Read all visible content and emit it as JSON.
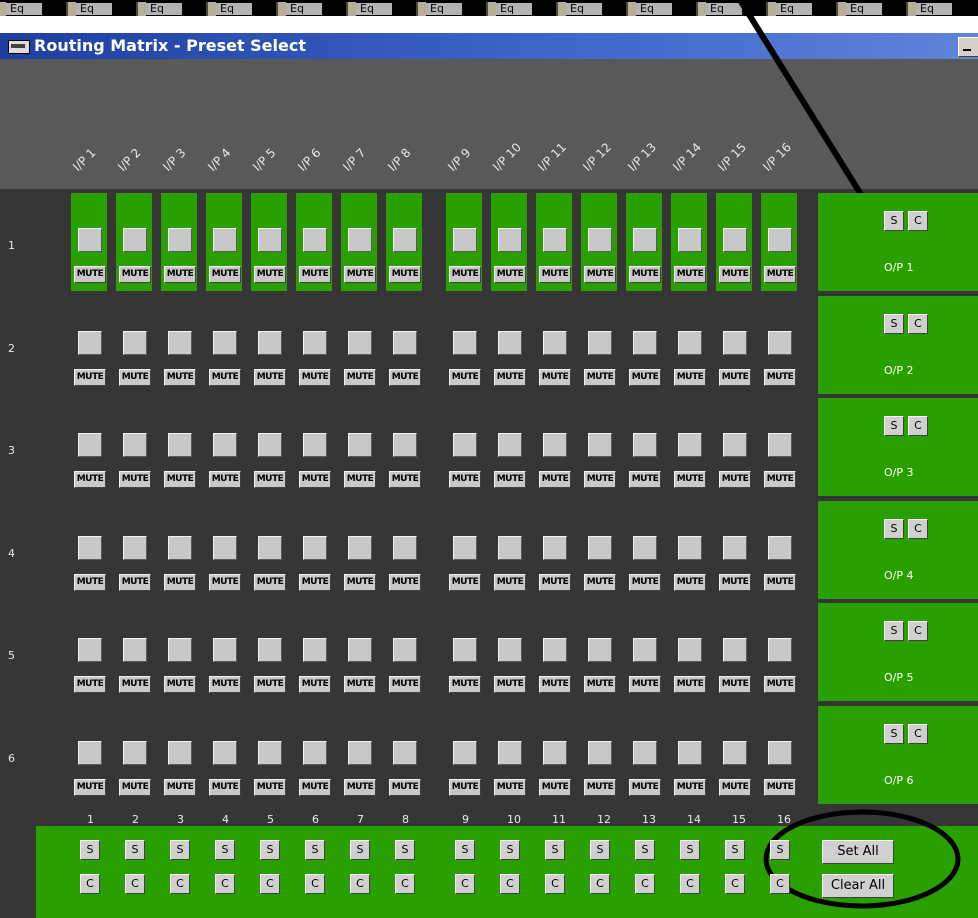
{
  "eq_strip": {
    "label": "Eq"
  },
  "window": {
    "title": "Routing Matrix - Preset Select"
  },
  "inputs": [
    "I/P 1",
    "I/P 2",
    "I/P 3",
    "I/P 4",
    "I/P 5",
    "I/P 6",
    "I/P 7",
    "I/P 8",
    "I/P 9",
    "I/P 10",
    "I/P 11",
    "I/P 12",
    "I/P 13",
    "I/P 14",
    "I/P 15",
    "I/P 16"
  ],
  "rows": [
    "1",
    "2",
    "3",
    "4",
    "5",
    "6"
  ],
  "mute_label": "MUTE",
  "outputs": [
    "O/P 1",
    "O/P 2",
    "O/P 3",
    "O/P 4",
    "O/P 5",
    "O/P 6"
  ],
  "set_label": "S",
  "clear_label": "C",
  "column_numbers": [
    "1",
    "2",
    "3",
    "4",
    "5",
    "6",
    "7",
    "8",
    "9",
    "10",
    "11",
    "12",
    "13",
    "14",
    "15",
    "16"
  ],
  "set_all_label": "Set All",
  "clear_all_label": "Clear All",
  "highlighted_row": "1",
  "colors": {
    "active_green": "#2aa000",
    "panel_dark": "#363636",
    "header_gray": "#595959"
  }
}
